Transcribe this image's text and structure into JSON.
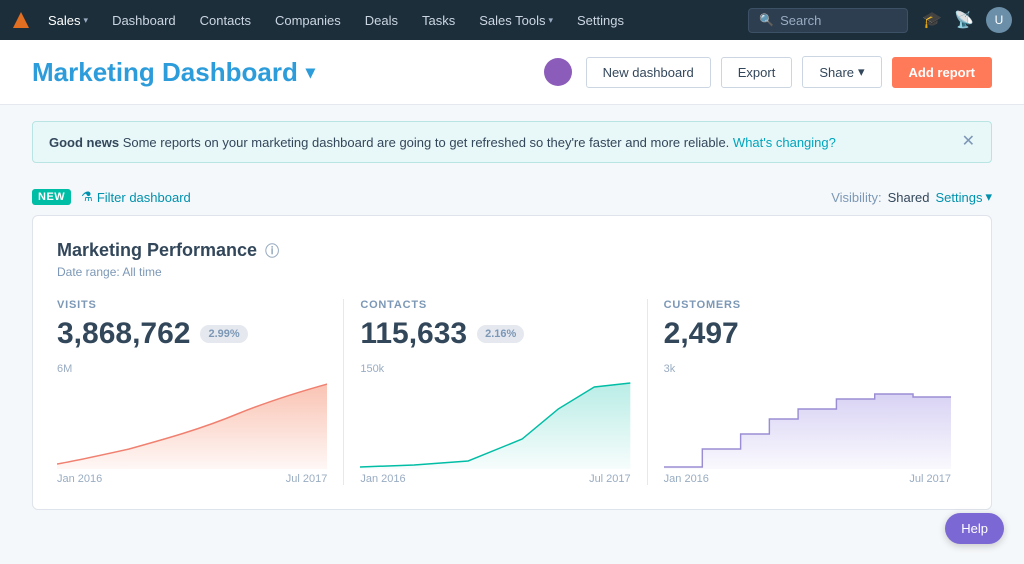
{
  "nav": {
    "logo": "🔶",
    "items": [
      {
        "label": "Sales",
        "hasChevron": true,
        "active": true
      },
      {
        "label": "Dashboard",
        "hasChevron": false
      },
      {
        "label": "Contacts",
        "hasChevron": false
      },
      {
        "label": "Companies",
        "hasChevron": false
      },
      {
        "label": "Deals",
        "hasChevron": false
      },
      {
        "label": "Tasks",
        "hasChevron": false
      },
      {
        "label": "Sales Tools",
        "hasChevron": true
      },
      {
        "label": "Settings",
        "hasChevron": false
      }
    ],
    "search_placeholder": "Search",
    "avatar_initial": "U"
  },
  "header": {
    "title": "Marketing Dashboard",
    "buttons": {
      "new_dashboard": "New dashboard",
      "export": "Export",
      "share": "Share",
      "add_report": "Add report"
    }
  },
  "banner": {
    "prefix_bold": "Good news",
    "text": "Some reports on your marketing dashboard are going to get refreshed so they're faster and more reliable.",
    "link_text": "What's changing?"
  },
  "toolbar": {
    "new_badge": "NEW",
    "filter_label": "Filter dashboard",
    "visibility_label": "Visibility:",
    "visibility_value": "Shared",
    "settings_label": "Settings"
  },
  "card": {
    "title": "Marketing Performance",
    "subtitle": "Date range: All time",
    "metrics": [
      {
        "label": "VISITS",
        "value": "3,868,762",
        "badge": "2.99%",
        "y_label": "6M",
        "x_labels": [
          "Jan 2016",
          "Jul 2017"
        ],
        "chart_color": "#f8b4a0",
        "chart_stroke": "#f08070",
        "chart_type": "area_rise"
      },
      {
        "label": "CONTACTS",
        "value": "115,633",
        "badge": "2.16%",
        "y_label": "150k",
        "x_labels": [
          "Jan 2016",
          "Jul 2017"
        ],
        "chart_color": "#a8e8e0",
        "chart_stroke": "#00bda5",
        "chart_type": "area_sharp"
      },
      {
        "label": "CUSTOMERS",
        "value": "2,497",
        "badge": null,
        "y_label": "3k",
        "x_labels": [
          "Jan 2016",
          "Jul 2017"
        ],
        "chart_color": "#c8bfef",
        "chart_stroke": "#9b8dd4",
        "chart_type": "area_steps"
      }
    ]
  },
  "help_button": "Help"
}
